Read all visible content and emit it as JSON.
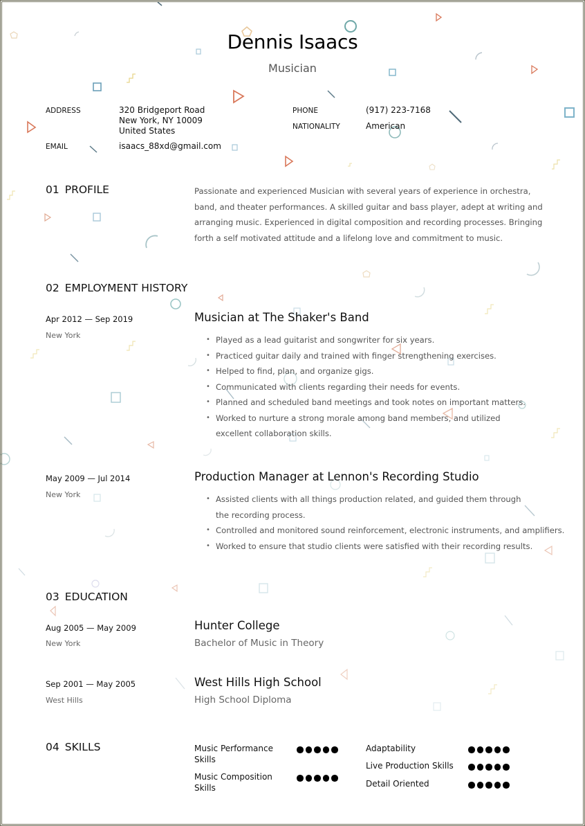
{
  "header": {
    "name": "Dennis Isaacs",
    "job_title": "Musician"
  },
  "contact": {
    "address_label": "ADDRESS",
    "address_lines": [
      "320 Bridgeport Road",
      "New York, NY 10009",
      "United States"
    ],
    "email_label": "EMAIL",
    "email": "isaacs_88xd@gmail.com",
    "phone_label": "PHONE",
    "phone": "(917) 223-7168",
    "nationality_label": "NATIONALITY",
    "nationality": "American"
  },
  "profile": {
    "number": "01",
    "heading": "PROFILE",
    "text": "Passionate and experienced Musician with several years of experience in orchestra, band, and theater performances. A skilled guitar and bass player, adept at writing and arranging music. Experienced in digital composition and recording processes. Bringing forth a self motivated attitude and a lifelong love and commitment to music."
  },
  "employment": {
    "number": "02",
    "heading": "EMPLOYMENT HISTORY",
    "jobs": [
      {
        "dates": "Apr 2012 — Sep 2019",
        "location": "New York",
        "title": "Musician at The Shaker's Band",
        "bullets": [
          "Played as a lead guitarist and songwriter for six years.",
          "Practiced guitar daily and trained with finger strengthening exercises.",
          "Helped to find, plan, and organize gigs.",
          "Communicated with clients regarding their needs for events.",
          "Planned and scheduled band meetings and took notes on important matters.",
          "Worked to nurture a strong morale among band members, and utilized excellent collaboration skills."
        ]
      },
      {
        "dates": "May 2009 — Jul 2014",
        "location": "New York",
        "title": "Production Manager at Lennon's Recording Studio",
        "bullets": [
          "Assisted clients with all things production related, and guided them through the recording process.",
          "Controlled and monitored sound reinforcement, electronic instruments, and amplifiers.",
          "Worked to ensure that studio clients were satisfied with their recording results."
        ]
      }
    ]
  },
  "education": {
    "number": "03",
    "heading": "EDUCATION",
    "entries": [
      {
        "dates": "Aug 2005 — May 2009",
        "location": "New York",
        "school": "Hunter College",
        "degree": "Bachelor of Music in Theory"
      },
      {
        "dates": "Sep 2001 — May 2005",
        "location": "West Hills",
        "school": "West Hills High School",
        "degree": "High School Diploma"
      }
    ]
  },
  "skills": {
    "number": "04",
    "heading": "SKILLS",
    "max_level": 5,
    "left": [
      {
        "name": "Music Performance Skills",
        "level": 5
      },
      {
        "name": "Music Composition Skills",
        "level": 5
      }
    ],
    "right": [
      {
        "name": "Adaptability",
        "level": 5
      },
      {
        "name": "Live Production Skills",
        "level": 5
      },
      {
        "name": "Detail Oriented",
        "level": 5
      }
    ]
  },
  "colors": {
    "teal": "#6fa8a8",
    "blue": "#7eb3c9",
    "coral": "#d9785a",
    "yellow": "#e8d58a",
    "slate": "#4f6a78",
    "border": "#6e6e5a"
  }
}
